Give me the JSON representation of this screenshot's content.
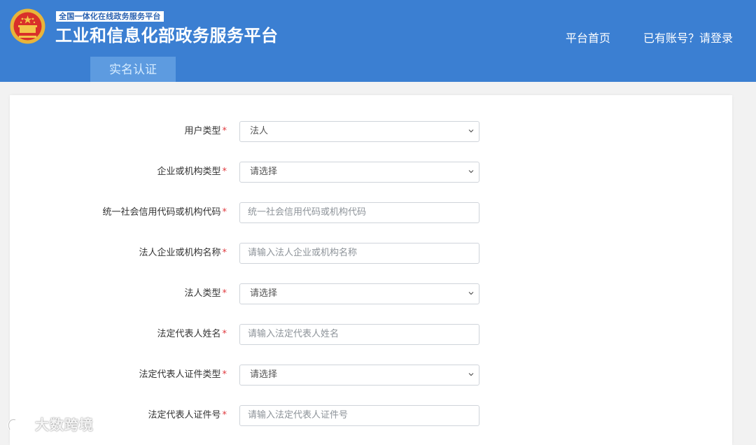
{
  "header": {
    "subtitle": "全国一体化在线政务服务平台",
    "title": "工业和信息化部政务服务平台",
    "nav": {
      "home": "平台首页",
      "login": "已有账号？请登录"
    },
    "tab": "实名认证"
  },
  "form": {
    "required_mark": "*",
    "fields": [
      {
        "label": "用户类型",
        "type": "select",
        "value": "法人"
      },
      {
        "label": "企业或机构类型",
        "type": "select",
        "value": "请选择"
      },
      {
        "label": "统一社会信用代码或机构代码",
        "type": "input",
        "placeholder": "统一社会信用代码或机构代码"
      },
      {
        "label": "法人企业或机构名称",
        "type": "input",
        "placeholder": "请输入法人企业或机构名称"
      },
      {
        "label": "法人类型",
        "type": "select",
        "value": "请选择"
      },
      {
        "label": "法定代表人姓名",
        "type": "input",
        "placeholder": "请输入法定代表人姓名"
      },
      {
        "label": "法定代表人证件类型",
        "type": "select",
        "value": "请选择"
      },
      {
        "label": "法定代表人证件号",
        "type": "input",
        "placeholder": "请输入法定代表人证件号"
      }
    ]
  },
  "watermark": "大数跨境",
  "colors": {
    "header_bg": "#3b7fd2",
    "tab_bg": "#5d9be0",
    "required": "#e0393e"
  }
}
